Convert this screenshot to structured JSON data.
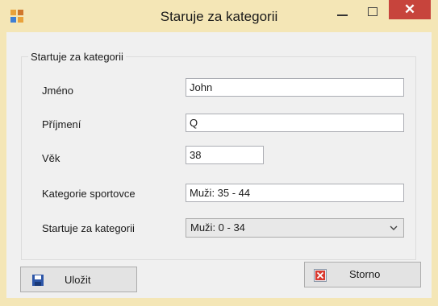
{
  "window": {
    "title": "Staruje za kategorii"
  },
  "group": {
    "legend": "Startuje za kategorii"
  },
  "fields": {
    "first_name": {
      "label": "Jméno",
      "value": "John"
    },
    "last_name": {
      "label": "Příjmení",
      "value": "Q"
    },
    "age": {
      "label": "Věk",
      "value": "38"
    },
    "athlete_category": {
      "label": "Kategorie sportovce",
      "value": "Muži: 35 - 44"
    },
    "start_category": {
      "label": "Startuje za kategorii",
      "selected": "Muži: 0 - 34"
    }
  },
  "buttons": {
    "save": "Uložit",
    "cancel": "Storno"
  },
  "icons": {
    "app": "app-windows-icon",
    "minimize": "minimize-icon",
    "maximize": "maximize-icon",
    "close": "close-icon",
    "dropdown": "chevron-down-icon",
    "save": "floppy-disk-icon",
    "cancel": "red-x-icon"
  },
  "colors": {
    "frame": "#f4e6b6",
    "close_button": "#c7443c",
    "client": "#f0f0f0"
  }
}
